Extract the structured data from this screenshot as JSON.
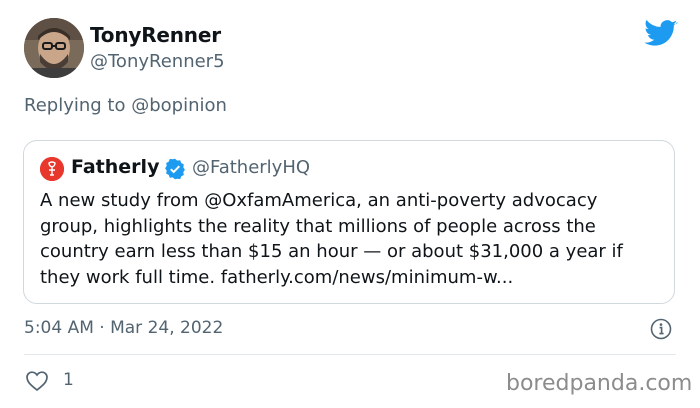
{
  "tweet": {
    "author": {
      "display_name": "TonyRenner",
      "handle": "@TonyRenner5"
    },
    "replying_to": {
      "prefix": "Replying to ",
      "mention": "@bopinion"
    },
    "quoted": {
      "display_name": "Fatherly",
      "handle": "@FatherlyHQ",
      "verified": true,
      "logo_icon": "fatherly-logo-icon",
      "body_lines": [
        "A new study from @OxfamAmerica, an anti-poverty advocacy",
        "group, highlights the reality that millions of people across the",
        "country earn less than $15 an hour — or about $31,000 a year if",
        "they work full time. fatherly.com/news/minimum-w..."
      ]
    },
    "timestamp": "5:04 AM · Mar 24, 2022",
    "like_count": "1"
  },
  "icons": {
    "brand": "twitter-bird-icon",
    "info": "info-icon",
    "like": "heart-icon",
    "verified": "verified-badge-icon"
  },
  "colors": {
    "twitter_blue": "#1d9bf0",
    "secondary_text": "#536471",
    "fatherly_red": "#e8372c",
    "border": "#cfd9de"
  },
  "watermark": "boredpanda.com"
}
